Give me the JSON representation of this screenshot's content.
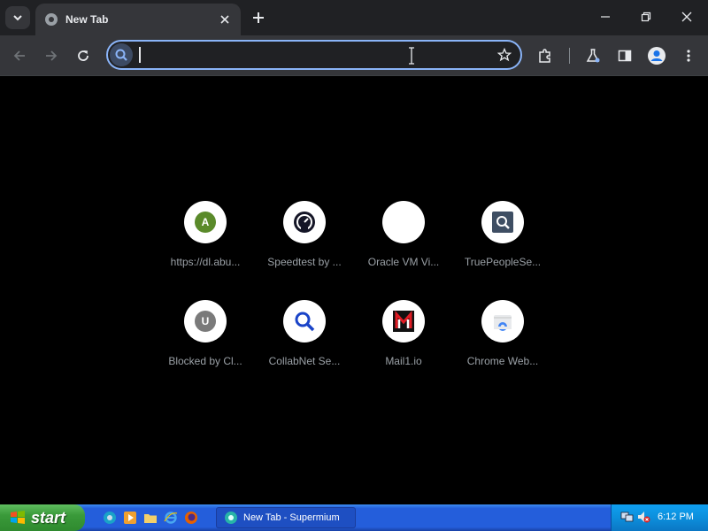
{
  "browser": {
    "tab": {
      "title": "New Tab"
    },
    "omnibox": {
      "value": "",
      "placeholder": ""
    }
  },
  "shortcuts": [
    {
      "label": "https://dl.abu...",
      "icon": "letter-a-icon",
      "letter": "A",
      "color": "#5a8a2a"
    },
    {
      "label": "Speedtest by ...",
      "icon": "speedtest-icon"
    },
    {
      "label": "Oracle VM Vi...",
      "icon": "blank-icon"
    },
    {
      "label": "TruePeopleSe...",
      "icon": "truepeople-search-icon"
    },
    {
      "label": "Blocked by Cl...",
      "icon": "letter-u-icon",
      "letter": "U",
      "color": "#7a7a7a"
    },
    {
      "label": "CollabNet Se...",
      "icon": "search-icon"
    },
    {
      "label": "Mail1.io",
      "icon": "mail1-icon"
    },
    {
      "label": "Chrome Web...",
      "icon": "chrome-web-store-icon"
    }
  ],
  "taskbar": {
    "start_label": "start",
    "task_label": "New Tab - Supermium",
    "clock": "6:12 PM"
  },
  "colors": {
    "accent": "#8ab4f8",
    "toolbar": "#35363a",
    "titlebar": "#202124",
    "taskbar": "#245edb",
    "start": "#3a9a3a"
  }
}
